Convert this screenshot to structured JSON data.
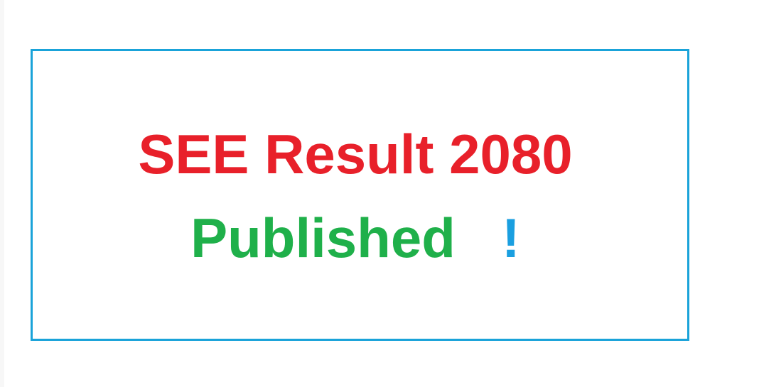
{
  "banner": {
    "headline": "SEE Result 2080",
    "status_word": "Published",
    "exclamation": "!",
    "colors": {
      "headline": "#e8202a",
      "status_word": "#1fb04a",
      "exclamation": "#1a9fe0",
      "frame_border": "#1aa3d9",
      "background": "#ffffff"
    }
  }
}
